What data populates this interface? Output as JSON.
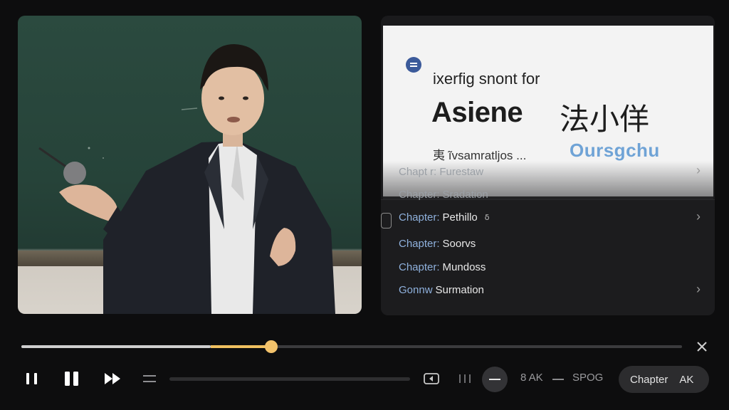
{
  "slide": {
    "subtitle": "ixerfig snont for",
    "title": "Asiene",
    "title_cjk": "法小佯",
    "footer": "夷 ĩvsamratljos ...",
    "brand": "Oursgchu",
    "brand_color": "#6fa3d6"
  },
  "chapters": [
    {
      "prefix": "Chapt",
      "title": "r: Furestaw",
      "dim": true
    },
    {
      "prefix": "Chapter:",
      "title": "Sradation",
      "dim": true
    },
    {
      "prefix": "Chapter:",
      "title": "Pethillo",
      "badge": "ẟ",
      "active": true
    },
    {
      "prefix": "Chapter:",
      "title": "Soorvs"
    },
    {
      "prefix": "Chapter:",
      "title": "Mundoss"
    },
    {
      "prefix": "Gonnw",
      "title": "Surmation"
    }
  ],
  "progress": {
    "buffered": 0.287,
    "played": 0.378,
    "accent": "#f0c060"
  },
  "controls": {
    "speed_label": "8 AK",
    "quality_label": "SPOG",
    "chapter_label": "Chapter",
    "chapter_badge": "AK"
  },
  "icons": [
    "play-pause-icon",
    "pause-icon",
    "fast-forward-icon",
    "menu-icon",
    "picture-in-picture-icon",
    "bars-icon",
    "minus-icon",
    "close-icon",
    "chevron-right-icon"
  ]
}
